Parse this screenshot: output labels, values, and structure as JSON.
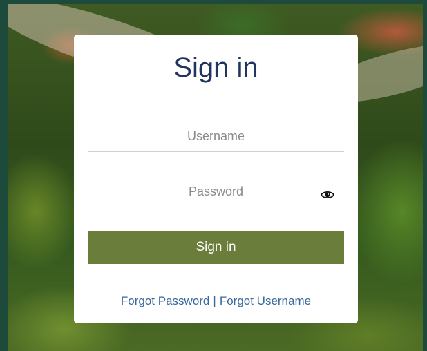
{
  "login": {
    "title": "Sign in",
    "username_placeholder": "Username",
    "password_placeholder": "Password",
    "signin_label": "Sign in",
    "forgot_password": "Forgot Password",
    "separator": "|",
    "forgot_username": "Forgot Username"
  },
  "icons": {
    "password_toggle": "eye-icon"
  },
  "colors": {
    "button": "#6b7d3a",
    "title": "#1f3560",
    "link": "#3a6a9a",
    "page_border": "#1d4a3a"
  }
}
